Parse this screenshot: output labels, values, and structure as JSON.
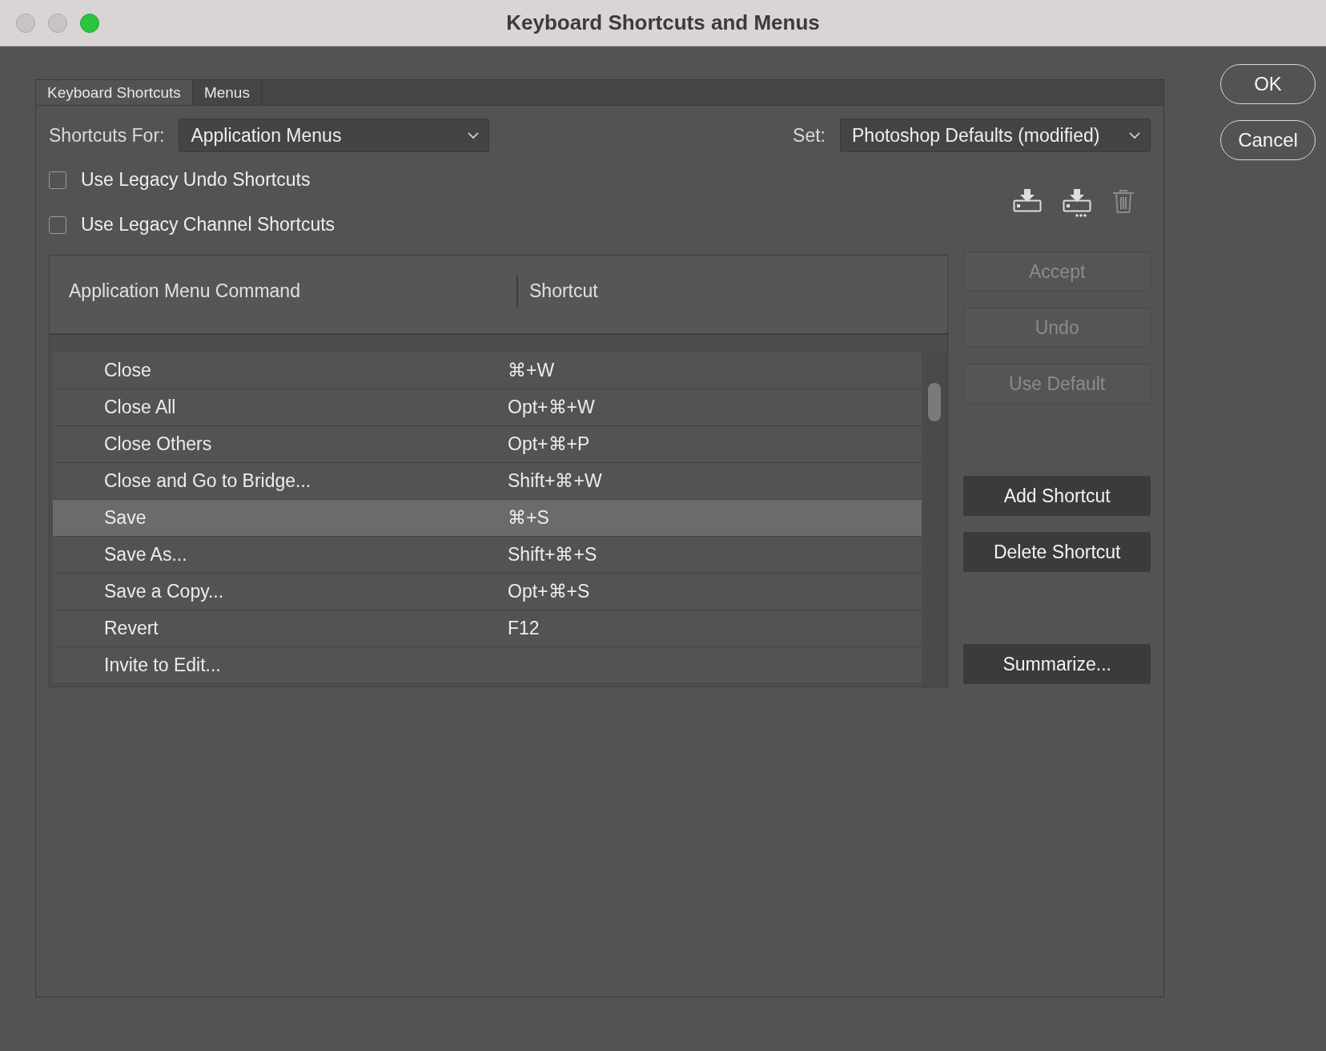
{
  "window": {
    "title": "Keyboard Shortcuts and Menus"
  },
  "tabs": [
    {
      "label": "Keyboard Shortcuts",
      "selected": true
    },
    {
      "label": "Menus",
      "selected": false
    }
  ],
  "shortcuts_for": {
    "label": "Shortcuts For:",
    "value": "Application Menus"
  },
  "set": {
    "label": "Set:",
    "value": "Photoshop Defaults (modified)"
  },
  "options": [
    {
      "label": "Use Legacy Undo Shortcuts",
      "checked": false
    },
    {
      "label": "Use Legacy Channel Shortcuts",
      "checked": false
    }
  ],
  "table": {
    "columns": [
      "Application Menu Command",
      "Shortcut"
    ],
    "rows": [
      {
        "command": "Close",
        "shortcut": "⌘+W",
        "selected": false
      },
      {
        "command": "Close All",
        "shortcut": "Opt+⌘+W",
        "selected": false
      },
      {
        "command": "Close Others",
        "shortcut": "Opt+⌘+P",
        "selected": false
      },
      {
        "command": "Close and Go to Bridge...",
        "shortcut": "Shift+⌘+W",
        "selected": false
      },
      {
        "command": "Save",
        "shortcut": "⌘+S",
        "selected": true
      },
      {
        "command": "Save As...",
        "shortcut": "Shift+⌘+S",
        "selected": false
      },
      {
        "command": "Save a Copy...",
        "shortcut": "Opt+⌘+S",
        "selected": false
      },
      {
        "command": "Revert",
        "shortcut": "F12",
        "selected": false
      },
      {
        "command": "Invite to Edit...",
        "selected": false
      }
    ]
  },
  "button_groups": [
    {
      "buttons": [
        {
          "label": "Accept",
          "disabled": true
        },
        {
          "label": "Undo",
          "disabled": true
        },
        {
          "label": "Use Default",
          "disabled": true
        }
      ]
    },
    {
      "buttons": [
        {
          "label": "Add Shortcut",
          "disabled": false
        },
        {
          "label": "Delete Shortcut",
          "disabled": false
        }
      ]
    },
    {
      "buttons": [
        {
          "label": "Summarize...",
          "disabled": false
        }
      ]
    }
  ],
  "dialog_buttons": [
    "OK",
    "Cancel"
  ]
}
